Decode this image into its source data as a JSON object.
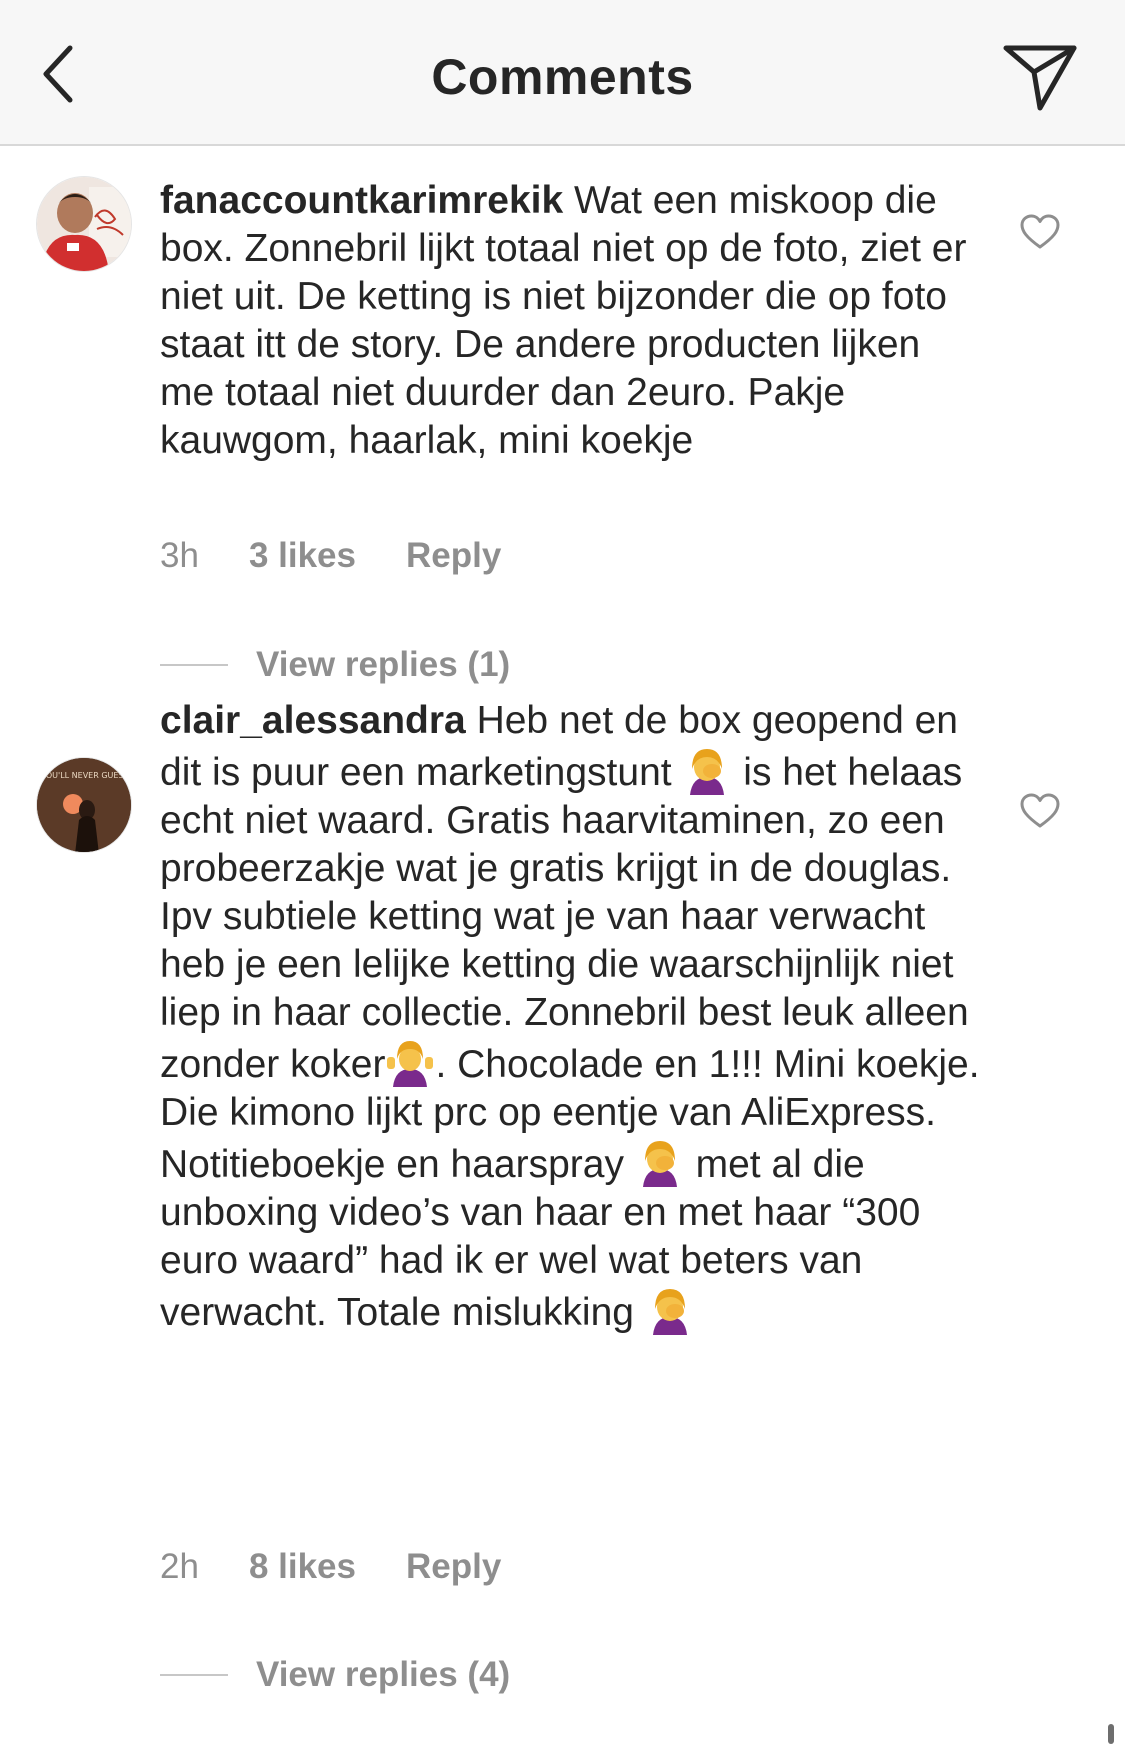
{
  "header": {
    "title": "Comments",
    "back_icon": "chevron-left-icon",
    "send_icon": "paper-plane-icon"
  },
  "comments": [
    {
      "username": "fanaccountkarimrekik",
      "text": "Wat een miskoop die box. Zonnebril lijkt totaal niet op de foto, ziet er niet uit. De ketting is niet bijzonder die op foto staat itt de story. De andere producten lijken me totaal niet duurder dan 2euro. Pakje kauwgom, haarlak, mini koekje",
      "time": "3h",
      "likes": "3 likes",
      "reply": "Reply",
      "view_replies": "View replies (1)"
    },
    {
      "username": "clair_alessandra",
      "text_parts": [
        "Heb net de box geopend en  dit is puur een marketingstunt ",
        " is het helaas echt niet waard. Gratis haarvitaminen, zo een probeerzakje wat je gratis krijgt in de douglas. Ipv subtiele ketting wat je van haar verwacht heb je een lelijke ketting die waarschijnlijk niet liep in haar collectie. Zonnebril best leuk alleen zonder koker",
        ". Chocolade en 1!!! Mini koekje. Die kimono lijkt prc op eentje van AliExpress. Notitieboekje en haarspray ",
        " met al die unboxing video’s van haar en met haar “300 euro waard” had ik er wel wat beters van verwacht. Totale mislukking "
      ],
      "avatar_text": "YOU'LL NEVER GUESS",
      "emoji_names": [
        "facepalm-emoji",
        "shrug-emoji",
        "facepalm-emoji",
        "facepalm-emoji"
      ],
      "time": "2h",
      "likes": "8 likes",
      "reply": "Reply",
      "view_replies": "View replies (4)"
    }
  ],
  "colors": {
    "text": "#262626",
    "muted": "#8e8e8e",
    "header_bg": "#f7f7f7",
    "emoji_skin": "#f5c24b",
    "emoji_shirt": "#7a2a8c"
  }
}
